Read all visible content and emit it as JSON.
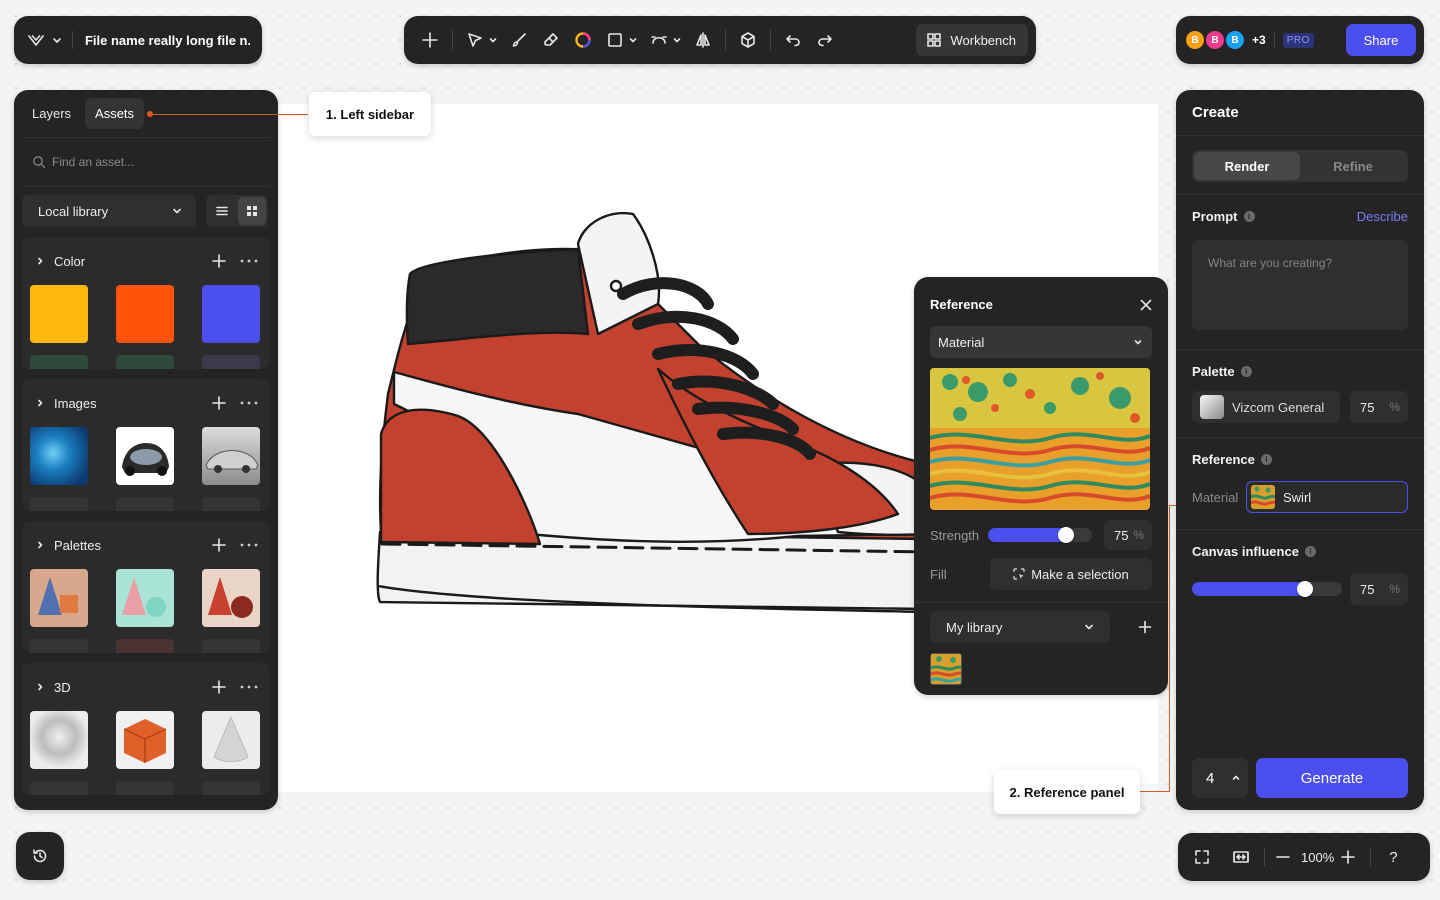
{
  "file": {
    "name": "File name really long file n..."
  },
  "toolbar": {
    "workbench_label": "Workbench"
  },
  "collab": {
    "avatars": [
      {
        "letter": "B",
        "color": "#f5a014"
      },
      {
        "letter": "B",
        "color": "#ec3a8c"
      },
      {
        "letter": "B",
        "color": "#1aa0f0"
      }
    ],
    "more": "+3",
    "plan": "PRO",
    "share_label": "Share"
  },
  "left_sidebar": {
    "tabs": [
      "Layers",
      "Assets"
    ],
    "active_tab": "Assets",
    "search_placeholder": "Find an asset...",
    "library": "Local library",
    "sections": [
      {
        "title": "Color"
      },
      {
        "title": "Images"
      },
      {
        "title": "Palettes"
      },
      {
        "title": "3D"
      }
    ],
    "colors": [
      "#ffb80f",
      "#ff520a",
      "#4c4ff0"
    ]
  },
  "callouts": {
    "left": "1. Left sidebar",
    "reference": "2. Reference panel"
  },
  "reference_popup": {
    "title": "Reference",
    "type": "Material",
    "strength_label": "Strength",
    "strength": 75,
    "pct": "%",
    "fill_label": "Fill",
    "fill_button": "Make a selection",
    "library": "My library"
  },
  "right_panel": {
    "title": "Create",
    "tabs": [
      "Render",
      "Refine"
    ],
    "active_tab": "Render",
    "prompt_label": "Prompt",
    "describe_link": "Describe",
    "prompt_placeholder": "What are you creating?",
    "palette_label": "Palette",
    "palette_name": "Vizcom General",
    "palette_value": 75,
    "reference_label": "Reference",
    "reference_kind": "Material",
    "reference_name": "Swirl",
    "canvas_influence_label": "Canvas influence",
    "canvas_influence": 75,
    "count": 4,
    "generate_label": "Generate"
  },
  "zoom": {
    "level": "100%",
    "help": "?"
  },
  "colors": {
    "accent": "#4c4ff0",
    "callout_line": "#e0561f",
    "panel": "#242424"
  }
}
